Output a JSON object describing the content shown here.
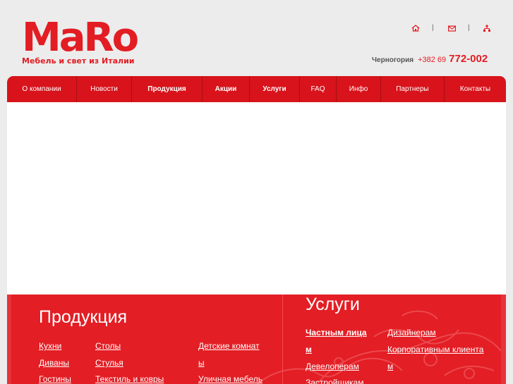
{
  "brand": {
    "logo": "MaRo",
    "tagline": "Мебель и свет из Италии",
    "color": "#e21d23"
  },
  "top_icons": [
    {
      "name": "home-icon",
      "separator": "|"
    },
    {
      "name": "mail-icon",
      "separator": "|"
    },
    {
      "name": "sitemap-icon",
      "separator": "|"
    }
  ],
  "contact": {
    "country": "Черногория",
    "code": "+382 69",
    "number": "772-002"
  },
  "nav": {
    "color": "#d8131b",
    "items": [
      {
        "label": "О компании",
        "bold": false
      },
      {
        "label": "Новости",
        "bold": false
      },
      {
        "label": "Продукция",
        "bold": true
      },
      {
        "label": "Акции",
        "bold": true
      },
      {
        "label": "Услуги",
        "bold": true
      },
      {
        "label": "FAQ",
        "bold": false
      },
      {
        "label": "Инфо",
        "bold": false
      },
      {
        "label": "Партнеры",
        "bold": false
      },
      {
        "label": "Контакты",
        "bold": false
      }
    ]
  },
  "footer": {
    "color": "#e31e25",
    "products": {
      "title": "Продукция",
      "col1": [
        "Кухни",
        "Диваны",
        "Гостины"
      ],
      "col2": [
        "Столы",
        "Стулья",
        "Текстиль и ковры"
      ],
      "col3": [
        "Детские комнат",
        "ы",
        "Уличная мебель"
      ]
    },
    "services": {
      "title": "Услуги",
      "col1": [
        "Частным лица",
        "м",
        "Девелоперам",
        "Застройщикам"
      ],
      "col2": [
        "Дизайнерам",
        "Корпоративным клиента",
        "м"
      ]
    }
  }
}
